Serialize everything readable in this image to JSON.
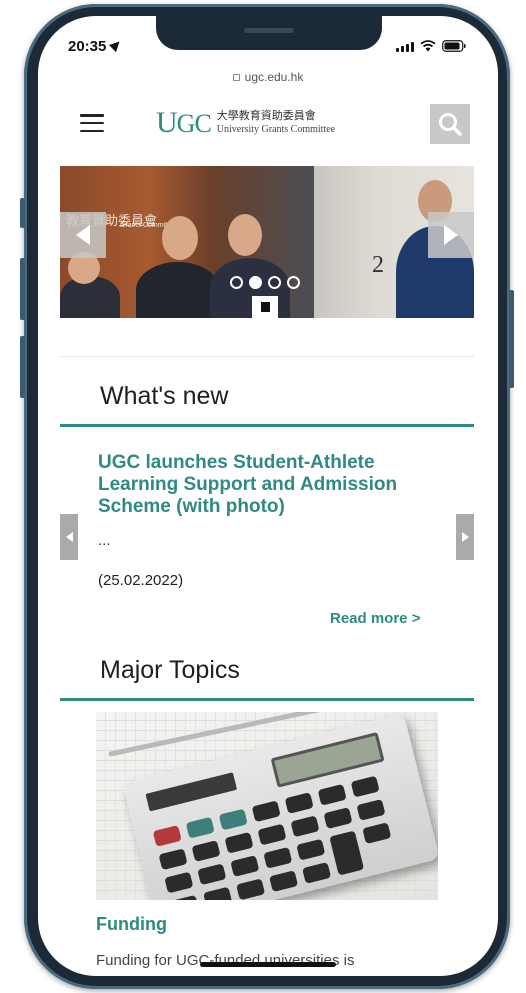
{
  "status": {
    "time": "20:35"
  },
  "browser": {
    "url": "ugc.edu.hk"
  },
  "header": {
    "logo_mark_u": "U",
    "logo_mark_gc": "GC",
    "logo_chinese": "大學教育資助委員會",
    "logo_english": "University Grants Committee"
  },
  "carousel": {
    "sign_text": "教育資助委員會",
    "sign_text_en": "Grants Commit",
    "slide_number_fragment": "2",
    "indicators": 3,
    "active_index": 0
  },
  "whats_new": {
    "heading": "What's new",
    "item_title": "UGC launches Student-Athlete Learning Support and Admission Scheme (with photo)",
    "item_excerpt": "...",
    "item_date": "(25.02.2022)",
    "read_more": "Read more >"
  },
  "major_topics": {
    "heading": "Major Topics",
    "topic_title": "Funding",
    "topic_desc": "Funding for UGC-funded universities is"
  },
  "colors": {
    "accent": "#2e8a83",
    "frame": "#1b2a36"
  },
  "icons": [
    "location-arrow-icon",
    "signal-icon",
    "wifi-icon",
    "battery-icon",
    "lock-icon",
    "hamburger-menu-icon",
    "search-icon",
    "chevron-left-icon",
    "chevron-right-icon",
    "pause-icon"
  ]
}
